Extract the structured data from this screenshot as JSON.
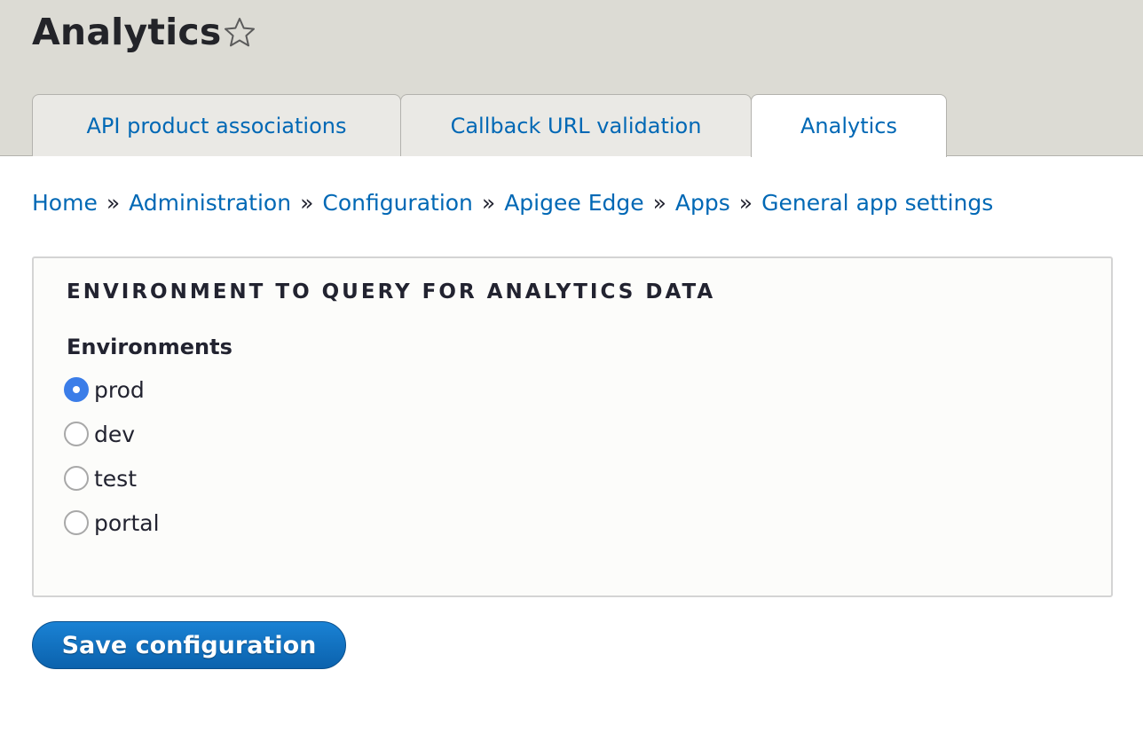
{
  "header": {
    "title": "Analytics",
    "favorite_icon": "star-outline-icon"
  },
  "tabs": [
    {
      "label": "API product associations",
      "active": false
    },
    {
      "label": "Callback URL validation",
      "active": false
    },
    {
      "label": "Analytics",
      "active": true
    }
  ],
  "breadcrumb": {
    "separator": "»",
    "items": [
      "Home",
      "Administration",
      "Configuration",
      "Apigee Edge",
      "Apps",
      "General app settings"
    ]
  },
  "form": {
    "fieldset_legend": "ENVIRONMENT TO QUERY FOR ANALYTICS DATA",
    "field_label": "Environments",
    "options": [
      {
        "label": "prod",
        "checked": true
      },
      {
        "label": "dev",
        "checked": false
      },
      {
        "label": "test",
        "checked": false
      },
      {
        "label": "portal",
        "checked": false
      }
    ],
    "submit_label": "Save configuration"
  },
  "colors": {
    "header_bg": "#dcdbd4",
    "link": "#0068b5",
    "radio_checked": "#3b7de8",
    "button": "#0b62ad"
  }
}
